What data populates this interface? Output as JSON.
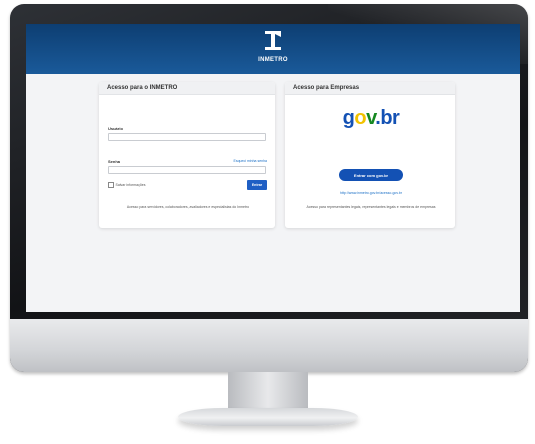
{
  "header": {
    "logo_text": "INMETRO",
    "color": "#14508c"
  },
  "left_card": {
    "title": "Acesso para o INMETRO",
    "user_label": "Usuário",
    "user_value": "",
    "password_label": "Senha",
    "password_value": "",
    "forgot_link": "Esqueci minha senha",
    "remember_label": "Salvar informações",
    "enter_button": "Entrar",
    "note": "Acesso para servidores, colaboradores, avaliadores e especialistas do Inmetro"
  },
  "right_card": {
    "title": "Acesso para Empresas",
    "govbr_logo": "gov.br",
    "gov_button": "Entrar com gov.br",
    "gov_link_prefix": "http://www.inmetro.gov.br/acesso-gov.br",
    "gov_link_suffix": "gov.br",
    "note": "Acesso para representantes legais, representantes legais e membros de empresas"
  },
  "colors": {
    "header_blue": "#14508c",
    "gov_blue": "#1351b4",
    "gov_yellow": "#f2c200",
    "gov_green": "#168821",
    "button_blue": "#1f5fc4"
  },
  "icons": {
    "logo": "inmetro-i-logo-icon",
    "checkbox": "checkbox-icon"
  }
}
